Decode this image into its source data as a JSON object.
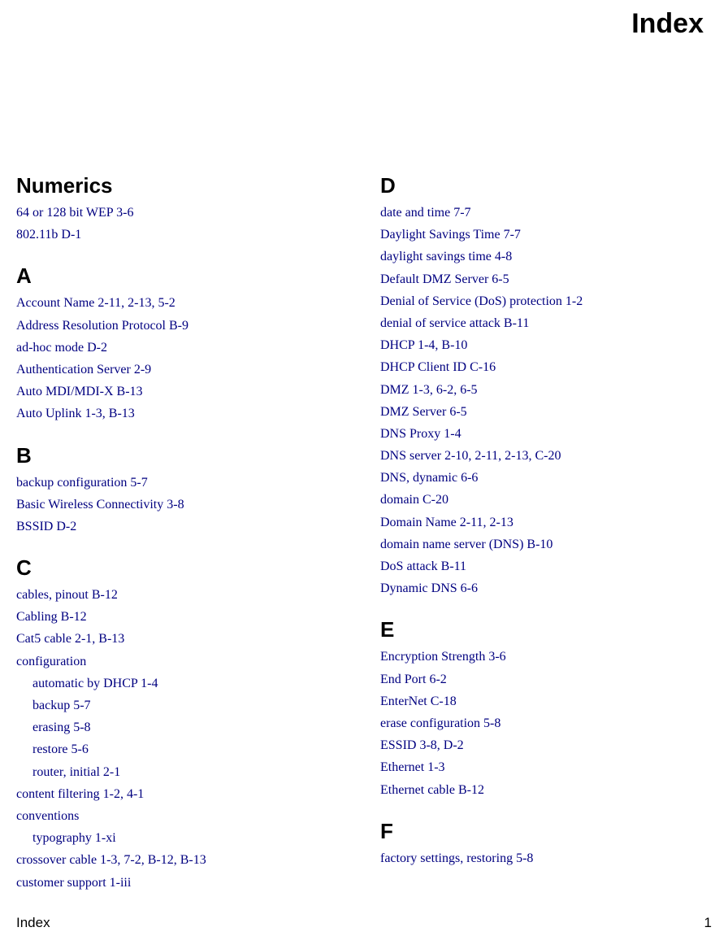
{
  "page_title": "Index",
  "footer_left": "Index",
  "footer_right": "1",
  "left_column": [
    {
      "type": "letter",
      "text": "Numerics"
    },
    {
      "type": "entry",
      "text": "64 or 128 bit WEP  3-6"
    },
    {
      "type": "entry",
      "text": "802.11b  D-1"
    },
    {
      "type": "letter",
      "text": "A"
    },
    {
      "type": "entry",
      "text": "Account Name  2-11, 2-13, 5-2"
    },
    {
      "type": "entry",
      "text": "Address Resolution Protocol  B-9"
    },
    {
      "type": "entry",
      "text": "ad-hoc mode  D-2"
    },
    {
      "type": "entry",
      "text": "Authentication Server  2-9"
    },
    {
      "type": "entry",
      "text": "Auto MDI/MDI-X  B-13"
    },
    {
      "type": "entry",
      "text": "Auto Uplink  1-3, B-13"
    },
    {
      "type": "letter",
      "text": "B"
    },
    {
      "type": "entry",
      "text": "backup configuration  5-7"
    },
    {
      "type": "entry",
      "text": "Basic Wireless Connectivity  3-8"
    },
    {
      "type": "entry",
      "text": "BSSID  D-2"
    },
    {
      "type": "letter",
      "text": "C"
    },
    {
      "type": "entry",
      "text": "cables, pinout  B-12"
    },
    {
      "type": "entry",
      "text": "Cabling  B-12"
    },
    {
      "type": "entry",
      "text": "Cat5 cable  2-1, B-13"
    },
    {
      "type": "entry",
      "text": "configuration"
    },
    {
      "type": "sub",
      "text": "automatic by DHCP  1-4"
    },
    {
      "type": "sub",
      "text": "backup  5-7"
    },
    {
      "type": "sub",
      "text": "erasing  5-8"
    },
    {
      "type": "sub",
      "text": "restore  5-6"
    },
    {
      "type": "sub",
      "text": "router, initial  2-1"
    },
    {
      "type": "entry",
      "text": "content filtering  1-2, 4-1"
    },
    {
      "type": "entry",
      "text": "conventions"
    },
    {
      "type": "sub",
      "text": "typography  1-xi"
    },
    {
      "type": "entry",
      "text": "crossover cable  1-3, 7-2, B-12, B-13"
    },
    {
      "type": "entry",
      "text": "customer support  1-iii"
    }
  ],
  "right_column": [
    {
      "type": "letter",
      "text": "D"
    },
    {
      "type": "entry",
      "text": "date and time  7-7"
    },
    {
      "type": "entry",
      "text": "Daylight Savings Time  7-7"
    },
    {
      "type": "entry",
      "text": "daylight savings time  4-8"
    },
    {
      "type": "entry",
      "text": "Default DMZ Server  6-5"
    },
    {
      "type": "entry",
      "text": "Denial of Service (DoS) protection  1-2"
    },
    {
      "type": "entry",
      "text": "denial of service attack  B-11"
    },
    {
      "type": "entry",
      "text": "DHCP  1-4, B-10"
    },
    {
      "type": "entry",
      "text": "DHCP Client ID  C-16"
    },
    {
      "type": "entry",
      "text": "DMZ  1-3, 6-2, 6-5"
    },
    {
      "type": "entry",
      "text": "DMZ Server  6-5"
    },
    {
      "type": "entry",
      "text": "DNS Proxy  1-4"
    },
    {
      "type": "entry",
      "text": "DNS server  2-10, 2-11, 2-13, C-20"
    },
    {
      "type": "entry",
      "text": "DNS, dynamic  6-6"
    },
    {
      "type": "entry",
      "text": "domain  C-20"
    },
    {
      "type": "entry",
      "text": "Domain Name  2-11, 2-13"
    },
    {
      "type": "entry",
      "text": "domain name server (DNS)  B-10"
    },
    {
      "type": "entry",
      "text": "DoS attack  B-11"
    },
    {
      "type": "entry",
      "text": "Dynamic DNS  6-6"
    },
    {
      "type": "letter",
      "text": "E"
    },
    {
      "type": "entry",
      "text": "Encryption Strength  3-6"
    },
    {
      "type": "entry",
      "text": "End Port  6-2"
    },
    {
      "type": "entry",
      "text": "EnterNet  C-18"
    },
    {
      "type": "entry",
      "text": "erase configuration  5-8"
    },
    {
      "type": "entry",
      "text": "ESSID  3-8, D-2"
    },
    {
      "type": "entry",
      "text": "Ethernet  1-3"
    },
    {
      "type": "entry",
      "text": "Ethernet cable  B-12"
    },
    {
      "type": "letter",
      "text": "F"
    },
    {
      "type": "entry",
      "text": "factory settings, restoring  5-8"
    }
  ]
}
